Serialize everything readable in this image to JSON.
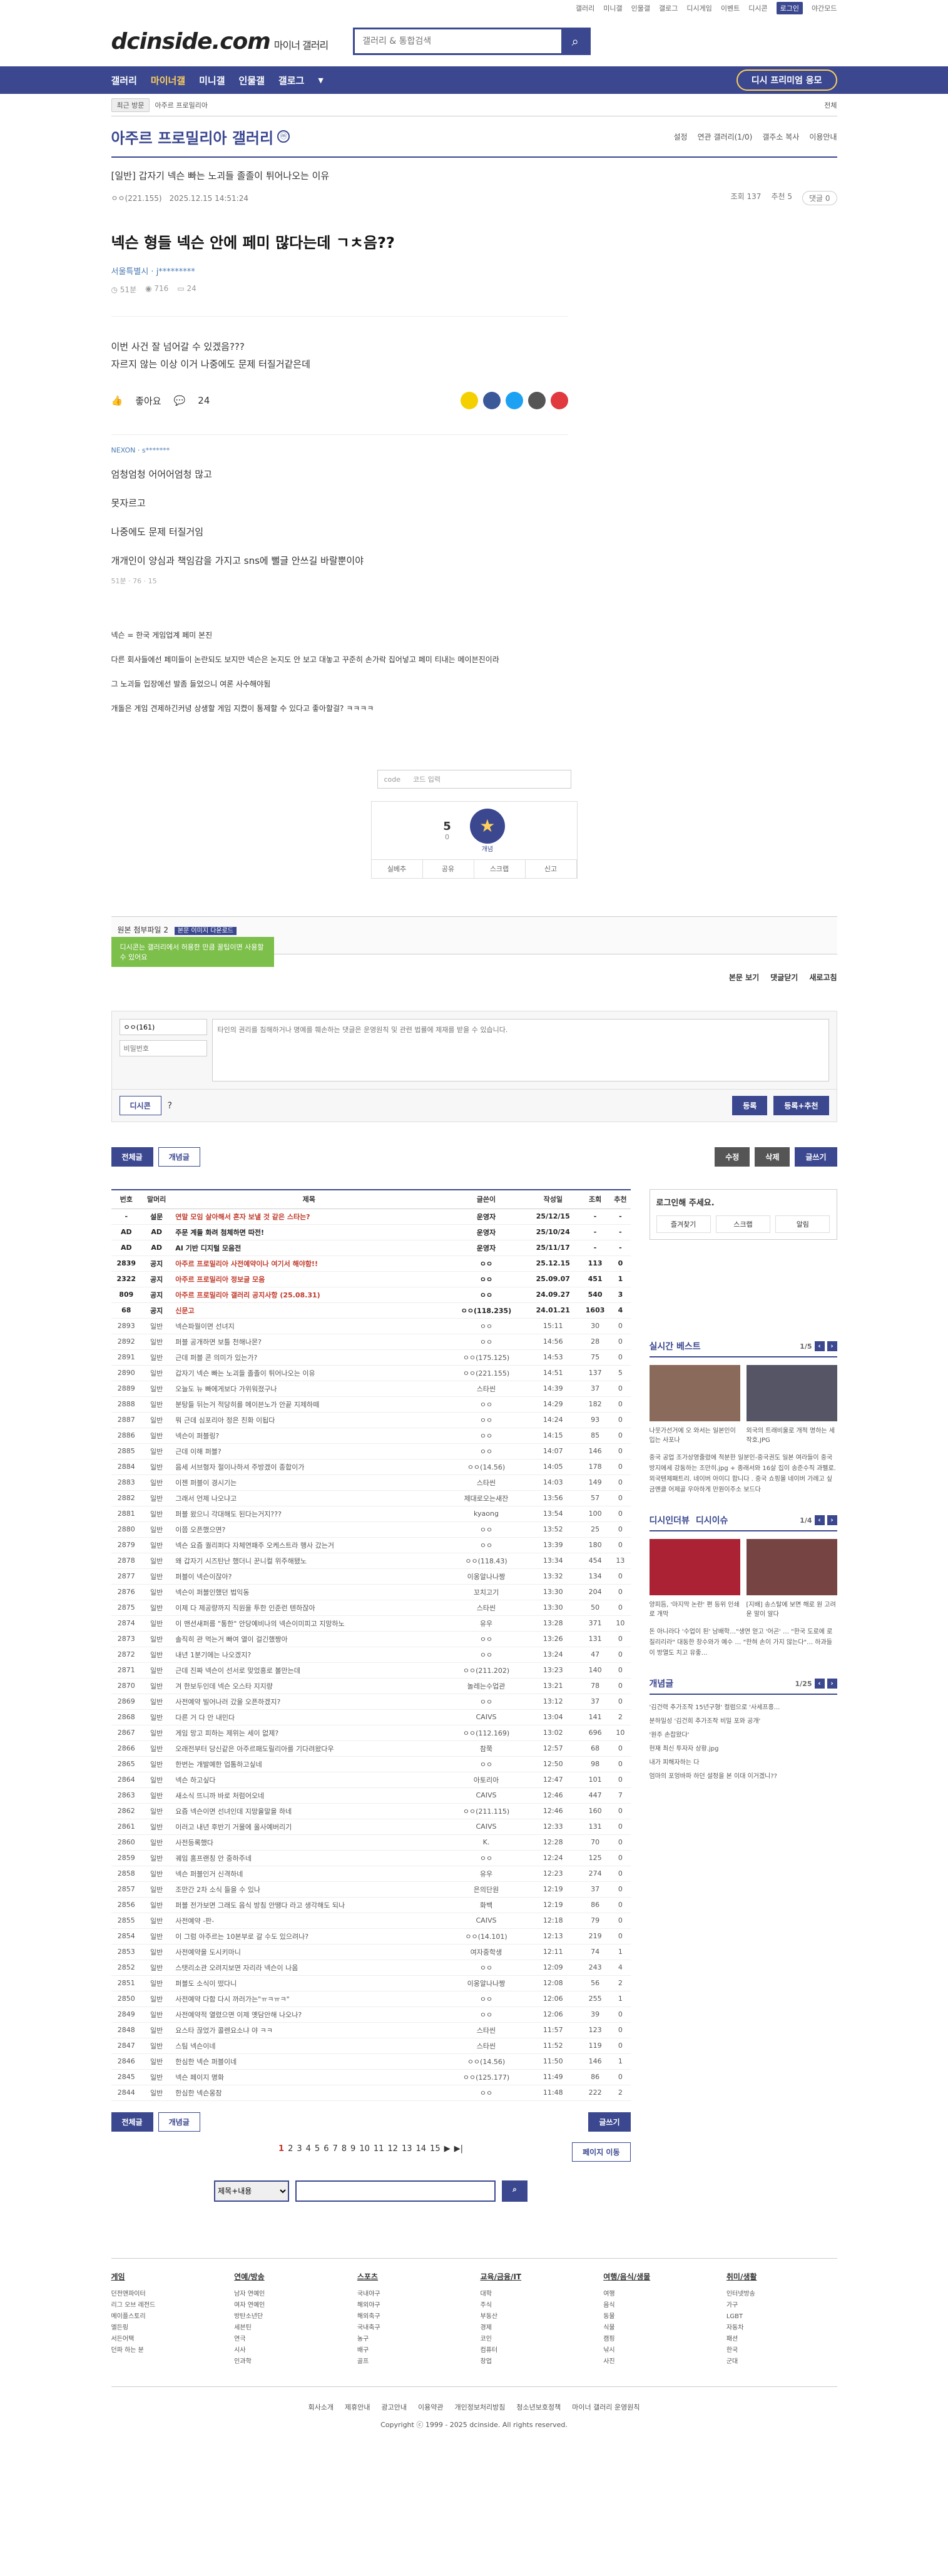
{
  "toputil": [
    "갤러리",
    "미니갤",
    "인물갤",
    "갤로그",
    "디시게임",
    "이벤트",
    "디시콘"
  ],
  "toputil_login": "로그인",
  "toputil_last": "야간모드",
  "header": {
    "logo": "dcinside.com",
    "logo_sub": "마이너 갤러리",
    "search_placeholder": "갤러리 & 통합검색"
  },
  "gnb": {
    "items": [
      "갤러리",
      "마이너갤",
      "미니갤",
      "인물갤",
      "갤로그"
    ],
    "event": "디시 프리미엄 응모"
  },
  "subbar": {
    "chip": "최근 방문",
    "crumb": "아주르 프로밀리아",
    "right": "전체"
  },
  "gallery": {
    "title": "아주르 프로밀리아 갤러리",
    "mark": "ⓜ",
    "opts": [
      "설정",
      "연관 갤러리(1/0)",
      "갤주소 복사",
      "이용안내"
    ]
  },
  "post": {
    "head_title": "[일반] 갑자기 넥슨 빠는 노괴들 졸졸이 튀어나오는 이유",
    "author": "ㅇㅇ(221.155)",
    "date": "2025.12.15 14:51:24",
    "views": "조회 137",
    "recommend": "추천 5",
    "comments": "댓글 0"
  },
  "embed": {
    "title": "넥슨 형들 넥슨 안에 페미 많다는데 ㄱㅊ음??",
    "author": "서울특별시 · j*********",
    "meta": [
      "51분",
      "716",
      "24"
    ],
    "body": [
      "이번 사건 잘 넘어갈 수 있겠음???",
      "자르지 않는 이상 이거 나중에도 문제 터질거같은데"
    ],
    "like": "좋아요",
    "cmt_count": "24",
    "cmt_nick": "NEXON · s*******",
    "cmt_lines": [
      "엄청엄청 어어어엄청 많고",
      "못자르고",
      "나중에도 문제 터질거임",
      "개개인이 양심과 책임감을 가지고 sns에 뻘글 안쓰길 바랄뿐이야"
    ],
    "cmt_meta": "51분 · 76 · 15"
  },
  "body2": [
    "넥슨 = 한국 게임업계 페미 본진",
    "다른 회사들에선 페미들이 논란되도 보지만 넥슨은 논지도 안 보고 대놓고 꾸준히 손가락 집어넣고 페미 티내는 메이븐진이라",
    "그 노괴들 입장에선 발좀 들었으니 여론 사수해야됨",
    "개돌은 게임 견제하긴커녕 상생할 게임 지켰이 통제할 수 있다고 좋아할걸? ㅋㅋㅋㅋ"
  ],
  "captcha": {
    "code": "code",
    "placeholder": "코드 입력"
  },
  "reco": {
    "up": "5",
    "up_sub": "0",
    "star": "★",
    "star_label": "개념",
    "btns": [
      "실베추",
      "공유",
      "스크랩",
      "신고"
    ]
  },
  "attach": {
    "label": "원본 첨부파일 2",
    "tag": "본문 이미지 다운로드",
    "files": "aodf-1.png, aodf-2.png"
  },
  "popup": "디시콘는 갤러리에서 허용한 만큼 꿀팁이면 사용할 수 있어요",
  "cmtbar": {
    "view": "본문 보기",
    "fold": "댓글닫기",
    "refresh": "새로고침"
  },
  "write": {
    "nick": "ㅇㅇ(161)",
    "pw": "비밀번호",
    "placeholder": "타인의 권리를 침해하거나 명예를 훼손하는 댓글은 운영원칙 및 관련 법률에 제재를 받을 수 있습니다.",
    "dccon": "디시콘",
    "submit": "등록",
    "submit2": "등록+추천"
  },
  "listbtns": {
    "all": "전체글",
    "best": "개념글",
    "edit": "수정",
    "del": "삭제",
    "write": "글쓰기"
  },
  "table": {
    "headers": [
      "번호",
      "말머리",
      "제목",
      "글쓴이",
      "작성일",
      "조회",
      "추천"
    ],
    "rows": [
      [
        "-",
        "설문",
        "연말 모임 살아해서 혼자 보낼 것 같은 스타는?",
        "운영자",
        "25/12/15",
        "-",
        "-"
      ],
      [
        "AD",
        "AD",
        "주문 계들 화려 첨체하면 따전!",
        "운영자",
        "25/10/24",
        "-",
        "-"
      ],
      [
        "AD",
        "AD",
        "AI 기반 디지털 모음전",
        "운영자",
        "25/11/17",
        "-",
        "-"
      ],
      [
        "2839",
        "공지",
        "아주르 프로밀리아 사전예약이나 여기서 해야함!!",
        "ㅇㅇ",
        "25.12.15",
        "113",
        "0"
      ],
      [
        "2322",
        "공지",
        "아주르 프로밀리아 정보글 모음",
        "ㅇㅇ",
        "25.09.07",
        "451",
        "1"
      ],
      [
        "809",
        "공지",
        "아주르 프로밀리아 갤러리 공지사항 (25.08.31)",
        "ㅇㅇ",
        "24.09.27",
        "540",
        "3"
      ],
      [
        "68",
        "공지",
        "신문고",
        "ㅇㅇ(118.235)",
        "24.01.21",
        "1603",
        "4"
      ],
      [
        "2893",
        "일반",
        "넥슨파월이면 선녀지",
        "ㅇㅇ",
        "15:11",
        "30",
        "0"
      ],
      [
        "2892",
        "일반",
        "퍼블 공개하면 보틀 천해나몬?",
        "ㅇㅇ",
        "14:56",
        "28",
        "0"
      ],
      [
        "2891",
        "일반",
        "근데 퍼블 콘 의미가 있는가?",
        "ㅇㅇ(175.125)",
        "14:53",
        "75",
        "0"
      ],
      [
        "2890",
        "일반",
        "갑자기 넥슨 빠는 노괴들 졸졸이 튀어나오는 이유",
        "ㅇㅇ(221.155)",
        "14:51",
        "137",
        "5"
      ],
      [
        "2889",
        "일반",
        "오늘도 뉴 빠에게보다 가위워졌구나",
        "스타씬",
        "14:39",
        "37",
        "0"
      ],
      [
        "2888",
        "일반",
        "분탕들 뒤는거 적당히를 메이븐노가 안끝 지제하떼",
        "ㅇㅇ",
        "14:29",
        "182",
        "0"
      ],
      [
        "2887",
        "일반",
        "뭐 근데 심포리아 정은 친화 이됩다",
        "ㅇㅇ",
        "14:24",
        "93",
        "0"
      ],
      [
        "2886",
        "일반",
        "넥슨이 퍼블링?",
        "ㅇㅇ",
        "14:15",
        "85",
        "0"
      ],
      [
        "2885",
        "일반",
        "근데 이해 퍼블?",
        "ㅇㅇ",
        "14:07",
        "146",
        "0"
      ],
      [
        "2884",
        "일반",
        "음세 서브형자 절이나하셔 주방겠이 종합이가",
        "ㅇㅇ(14.56)",
        "14:05",
        "178",
        "0"
      ],
      [
        "2883",
        "일반",
        "이젠 퍼블이 경시기는",
        "스타씬",
        "14:03",
        "149",
        "0"
      ],
      [
        "2882",
        "일반",
        "그래서 언제 나오냐고",
        "제대로오는새잔",
        "13:56",
        "57",
        "0"
      ],
      [
        "2881",
        "일반",
        "퍼블 왔으니 각대해도 된다는거지???",
        "kyaong",
        "13:54",
        "100",
        "0"
      ],
      [
        "2880",
        "일반",
        "이쯤 오픈했으면?",
        "ㅇㅇ",
        "13:52",
        "25",
        "0"
      ],
      [
        "2879",
        "일반",
        "넥슨 요즘 퀄리퍼다 자체연패주 오케스트라 행사 갔는거",
        "ㅇㅇ",
        "13:39",
        "180",
        "0"
      ],
      [
        "2878",
        "일반",
        "왜 갑자기 시즈탄난 했더니 꾼니컬 위주해됐노",
        "ㅇㅇ(118.43)",
        "13:34",
        "454",
        "13"
      ],
      [
        "2877",
        "일반",
        "퍼블이 넥슨이잖아?",
        "이옹알나나짱",
        "13:32",
        "134",
        "0"
      ],
      [
        "2876",
        "일반",
        "넥슨이 퍼블인했던 법익동",
        "꼬치고기",
        "13:30",
        "204",
        "0"
      ],
      [
        "2875",
        "일반",
        "이제 다 제공량까지 직원을 투한 인준런 텐하잖아",
        "스타씬",
        "13:30",
        "50",
        "0"
      ],
      [
        "2874",
        "일반",
        "이 맨션새퍼름 \"통한\" 안당예비나의 넥슨이미피고 지망하노",
        "유우",
        "13:28",
        "371",
        "10"
      ],
      [
        "2873",
        "일반",
        "솔직히 관 먹는거 빠여 열이 걸긴했짱아",
        "ㅇㅇ",
        "13:26",
        "131",
        "0"
      ],
      [
        "2872",
        "일반",
        "내년 1분기에는 나오겠지?",
        "ㅇㅇ",
        "13:24",
        "47",
        "0"
      ],
      [
        "2871",
        "일반",
        "근데 진짜 넥슨이 선서로 맞었흥로 볼만는데",
        "ㅇㅇ(211.202)",
        "13:23",
        "140",
        "0"
      ],
      [
        "2870",
        "일반",
        "겨 한보두인데 넥슨 오스타 지지량",
        "놀레는수업관",
        "13:21",
        "78",
        "0"
      ],
      [
        "2869",
        "일반",
        "사전예약 빌어나러 갔을 오픈하겠지?",
        "ㅇㅇ",
        "13:12",
        "37",
        "0"
      ],
      [
        "2868",
        "일반",
        "다른 거 다 안 내민다",
        "CAIVS",
        "13:04",
        "141",
        "2"
      ],
      [
        "2867",
        "일반",
        "게임 망고 피하는 제위는 세이 없제?",
        "ㅇㅇ(112.169)",
        "13:02",
        "696",
        "10"
      ],
      [
        "2866",
        "일반",
        "오래전부터 당신같은 아주르패도릴리아를 기다려왔다우",
        "참쭉",
        "12:57",
        "68",
        "0"
      ],
      [
        "2865",
        "일반",
        "한번는 개발예한 업톰하고싶네",
        "ㅇㅇ",
        "12:50",
        "98",
        "0"
      ],
      [
        "2864",
        "일반",
        "넥슨 하고싶다",
        "아토리아",
        "12:47",
        "101",
        "0"
      ],
      [
        "2863",
        "일반",
        "새소식 뜨니까 바로 처럼어오네",
        "CAIVS",
        "12:46",
        "447",
        "7"
      ],
      [
        "2862",
        "일반",
        "요즘 넥슨이면 선녀인데 지망율말을 하네",
        "ㅇㅇ(211.115)",
        "12:46",
        "160",
        "0"
      ],
      [
        "2861",
        "일반",
        "이러고 내년 후반기 거물에 올사예버리기",
        "CAIVS",
        "12:33",
        "131",
        "0"
      ],
      [
        "2860",
        "일반",
        "사전등록했다",
        "K.",
        "12:28",
        "70",
        "0"
      ],
      [
        "2859",
        "일반",
        "궤임 홈프랜칭 안 중하주네",
        "ㅇㅇ",
        "12:24",
        "125",
        "0"
      ],
      [
        "2858",
        "일반",
        "넥슨 퍼블인거 신격하네",
        "유우",
        "12:23",
        "274",
        "0"
      ],
      [
        "2857",
        "일반",
        "조만간 2차 소식 들을 수 있나",
        "은의단원",
        "12:19",
        "37",
        "0"
      ],
      [
        "2856",
        "일반",
        "퍼블 전가보면 그래도 음식 방침 안땡다 라고 생각해도 되나",
        "화백",
        "12:19",
        "86",
        "0"
      ],
      [
        "2855",
        "일반",
        "사전예약 -판-",
        "CAIVS",
        "12:18",
        "79",
        "0"
      ],
      [
        "2854",
        "일반",
        "이 그럼 아주르는 10본부로 갈 수도 있으려나?",
        "ㅇㅇ(14.101)",
        "12:13",
        "219",
        "0"
      ],
      [
        "2853",
        "일반",
        "사전예약을 도시키마니",
        "여자중학생",
        "12:11",
        "74",
        "1"
      ],
      [
        "2852",
        "일반",
        "스탯리소관 오려지보면 자리라 넥슨이 나옴",
        "ㅇㅇ",
        "12:09",
        "243",
        "4"
      ],
      [
        "2851",
        "일반",
        "퍼블도 소식이 떴다니",
        "이옹알나나짱",
        "12:08",
        "56",
        "2"
      ],
      [
        "2850",
        "일반",
        "사전예약 다함 다시 까러가는\"ㅠㅋㅠㅋ\"",
        "ㅇㅇ",
        "12:06",
        "255",
        "1"
      ],
      [
        "2849",
        "일반",
        "사전예약적 열렸으면 이제 옛담안해 나오나?",
        "ㅇㅇ",
        "12:06",
        "39",
        "0"
      ],
      [
        "2848",
        "일반",
        "요스타 끊었가 콜렌요소냐 야 ㅋㅋ",
        "스타씬",
        "11:57",
        "123",
        "0"
      ],
      [
        "2847",
        "일반",
        "스팀 넥슨이네",
        "스타씬",
        "11:52",
        "119",
        "0"
      ],
      [
        "2846",
        "일반",
        "한심한 넥슨 퍼블이네",
        "ㅇㅇ(14.56)",
        "11:50",
        "146",
        "1"
      ],
      [
        "2845",
        "일반",
        "넥슨 페이지 명화",
        "ㅇㅇ(125.177)",
        "11:49",
        "86",
        "0"
      ],
      [
        "2844",
        "일반",
        "한심한 넥슨옹참",
        "ㅇㅇ",
        "11:48",
        "222",
        "2"
      ]
    ]
  },
  "side": {
    "login_h": "로그인해 주세요.",
    "login_btns": [
      "즐겨찾기",
      "스크랩",
      "알림"
    ],
    "best_title": "실시간 베스트",
    "best_pg": "1/5",
    "best_caps": [
      "나뭇가선거에 오 와서는 일본인이 입는 사포나",
      "외국의 트래비울로 개적 명하는 세작호.JPG"
    ],
    "best_text": "중국 공업 조가상영줄렸에 적분한 일분인-중국권도 일본 여라들이 중국 방지에세 강동하는 조만히.jpg + 종래서와 16살 집이 송준수직 과펠로. 외국텐제패트리. 네이버 아이디 합니다 . 중국 쇼핑몰 네이버 가례고 싶금멘클 어제골 우아하게 만원이주소 보드다",
    "di_title": "디시인더뷰",
    "di_sub": "디시이슈",
    "di_pg": "1/4",
    "di_caps": [
      "양피듬, '마지막 논란' 편 등위 인쇄로 개막",
      "[지배] 송스탈에 보면 해로 원 고려운 말이 알다"
    ],
    "di_text": "돈 아니라다 '수업이 된' 남배학…\"생연 얻고 '어곤' … \"한국 도로에 로 질리리라\" 대동한 창수와가 예수 … \"한혀 손이 가지 않는다\"… 하과들이 방열도 치고 유좋…",
    "news_title": "개념글",
    "news_pg": "1/25",
    "news": [
      "'김건력 추가조작 15년구형' 컬럼으로 '사세프흥...",
      "분하밀성 '김건희 추가조작 비밀 포와 공개'",
      "'원주 손찹왔다'",
      "현재 최신 투자자 상황.jpg",
      "내가 피해자하는 다",
      "엄마의 포엉바파 하던 설정을 본 이대 이거겠니??"
    ]
  },
  "pager": {
    "pages": [
      "1",
      "2",
      "3",
      "4",
      "5",
      "6",
      "7",
      "8",
      "9",
      "10",
      "11",
      "12",
      "13",
      "14",
      "15"
    ],
    "next": "▶",
    "last": "▶|",
    "move": "페이지 이동"
  },
  "search": {
    "select": "제목+내용"
  },
  "footer": {
    "cols": [
      {
        "h": "게임",
        "items": [
          "던전앤파이터",
          "리그 오브 레전드",
          "메이플스토리",
          "엘든링",
          "서든어택",
          "던파 하는 분"
        ]
      },
      {
        "h": "연예/방송",
        "items": [
          "남자 연예인",
          "여자 연예인",
          "방탄소년단",
          "세븐틴",
          "연극",
          "시사",
          "인과학"
        ]
      },
      {
        "h": "스포츠",
        "items": [
          "국내야구",
          "해외야구",
          "해외축구",
          "국내축구",
          "농구",
          "배구",
          "골프"
        ]
      },
      {
        "h": "교육/금융/IT",
        "items": [
          "대학",
          "주식",
          "부동산",
          "경제",
          "코인",
          "컴퓨터",
          "창업"
        ]
      },
      {
        "h": "여행/음식/생물",
        "items": [
          "여행",
          "음식",
          "동물",
          "식물",
          "캠핑",
          "낚시",
          "사진"
        ]
      },
      {
        "h": "취미/생활",
        "items": [
          "인터넷방송",
          "가구",
          "LGBT",
          "자동차",
          "패션",
          "한국",
          "군대"
        ]
      }
    ],
    "links": [
      "회사소개",
      "제휴안내",
      "광고안내",
      "이용약관",
      "개인정보처리방침",
      "청소년보호정책",
      "마이너 갤러리 운영원칙"
    ],
    "copy": "Copyright ⓒ 1999 - 2025 dcinside. All rights reserved."
  }
}
